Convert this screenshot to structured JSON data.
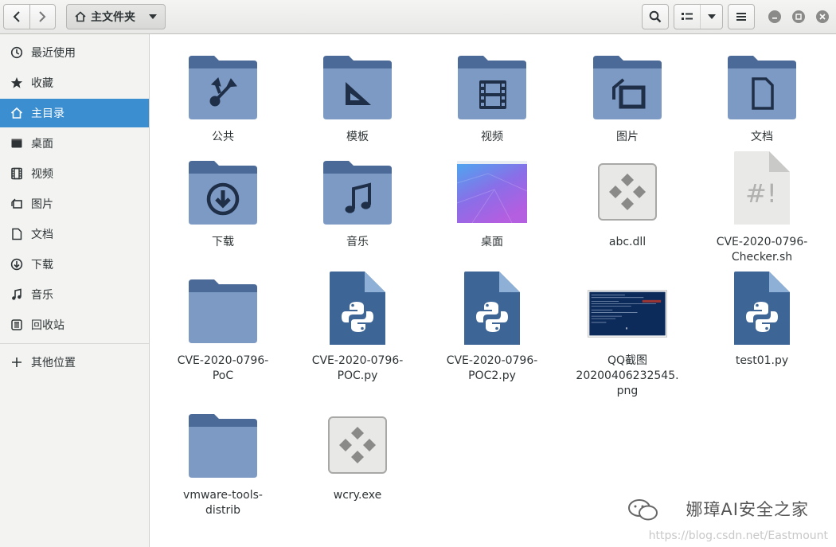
{
  "header": {
    "back_icon": "chevron-left-icon",
    "forward_icon": "chevron-right-icon",
    "path_label": "主文件夹",
    "home_icon": "home-icon",
    "dropdown_icon": "chevron-down-icon",
    "search_icon": "search-icon",
    "view_icon": "list-view-icon",
    "menu_icon": "hamburger-menu-icon",
    "window_buttons": [
      "minimize",
      "maximize",
      "close"
    ]
  },
  "sidebar": {
    "items": [
      {
        "label": "最近使用",
        "icon": "clock-icon"
      },
      {
        "label": "收藏",
        "icon": "star-icon"
      },
      {
        "label": "主目录",
        "icon": "home-icon",
        "active": true
      },
      {
        "label": "桌面",
        "icon": "desktop-icon"
      },
      {
        "label": "视频",
        "icon": "video-icon"
      },
      {
        "label": "图片",
        "icon": "picture-icon"
      },
      {
        "label": "文档",
        "icon": "document-icon"
      },
      {
        "label": "下载",
        "icon": "download-icon"
      },
      {
        "label": "音乐",
        "icon": "music-icon"
      },
      {
        "label": "回收站",
        "icon": "trash-icon"
      }
    ],
    "other_locations": {
      "label": "其他位置",
      "icon": "plus-icon"
    }
  },
  "files": [
    {
      "label": "公共",
      "type": "folder-public"
    },
    {
      "label": "模板",
      "type": "folder-templates"
    },
    {
      "label": "视频",
      "type": "folder-videos"
    },
    {
      "label": "图片",
      "type": "folder-pictures"
    },
    {
      "label": "文档",
      "type": "folder-documents"
    },
    {
      "label": "下载",
      "type": "folder-download"
    },
    {
      "label": "音乐",
      "type": "folder-music"
    },
    {
      "label": "桌面",
      "type": "desktop-thumbnail"
    },
    {
      "label": "abc.dll",
      "type": "executable"
    },
    {
      "label": "CVE-2020-0796-\nChecker.sh",
      "type": "shell-script"
    },
    {
      "label": "CVE-2020-0796-\nPoC",
      "type": "folder"
    },
    {
      "label": "CVE-2020-0796-\nPOC.py",
      "type": "python"
    },
    {
      "label": "CVE-2020-0796-\nPOC2.py",
      "type": "python"
    },
    {
      "label": "QQ截图\n20200406232545.\npng",
      "type": "image-thumbnail"
    },
    {
      "label": "test01.py",
      "type": "python"
    },
    {
      "label": "vmware-tools-\ndistrib",
      "type": "folder"
    },
    {
      "label": "wcry.exe",
      "type": "executable"
    }
  ],
  "watermark": {
    "title": "娜璋AI安全之家",
    "url": "https://blog.csdn.net/Eastmount"
  },
  "colors": {
    "folder_back": "#4c6a98",
    "folder_front": "#7d9ac4",
    "sidebar_active": "#3b8ed0",
    "python_blue": "#3d6596"
  }
}
